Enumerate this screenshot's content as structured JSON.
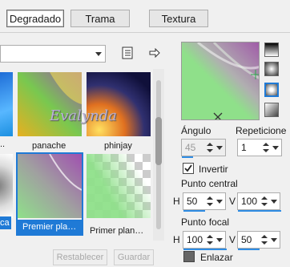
{
  "tabs": [
    "Degradado",
    "Trama",
    "Textura"
  ],
  "thumbnails": [
    {
      "caption": ""
    },
    {
      "caption": "panache"
    },
    {
      "caption": "phinjay"
    },
    {
      "caption": "ca"
    },
    {
      "caption": "Premier pla…"
    },
    {
      "caption": "Primer plan…"
    }
  ],
  "left_captions_partial": [
    "…"
  ],
  "watermark": "Evalynda",
  "buttons": {
    "reset": "Restablecer",
    "save": "Guardar"
  },
  "angle": {
    "label": "Ángulo",
    "value": "45"
  },
  "repeats": {
    "label": "Repeticione",
    "value": "1"
  },
  "invert": {
    "label": "Invertir",
    "checked": true
  },
  "center_point": {
    "label": "Punto central",
    "h_label": "H",
    "h_value": "50",
    "v_label": "V",
    "v_value": "100"
  },
  "focal_point": {
    "label": "Punto focal",
    "h_label": "H",
    "h_value": "100",
    "v_label": "V",
    "v_value": "50"
  },
  "link": {
    "label": "Enlazar"
  },
  "colors": {
    "accent": "#2f8de4",
    "purple": "#a05aa8",
    "green": "#8fe08a",
    "selection": "#1f7ad6"
  }
}
